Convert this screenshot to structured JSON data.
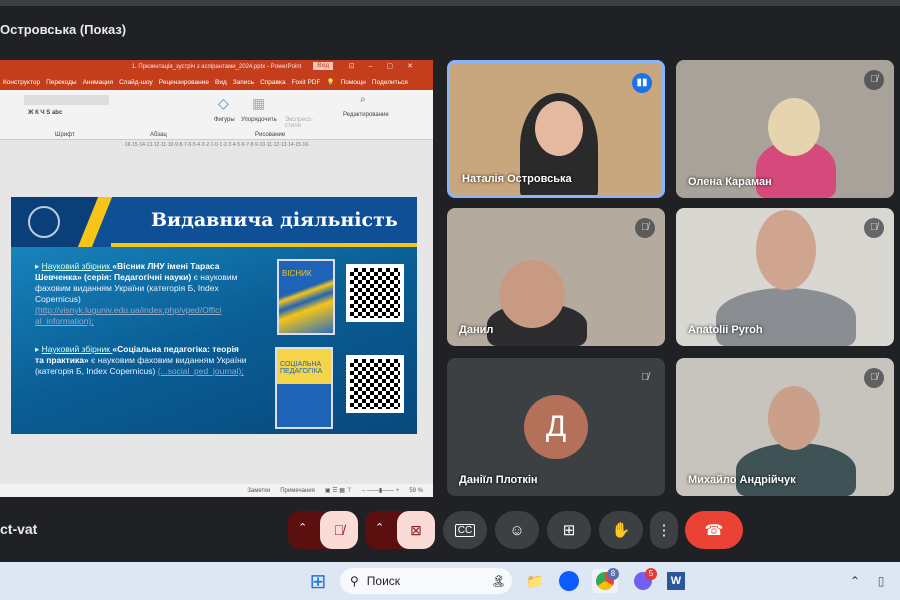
{
  "meeting": {
    "presenter_title": "Островська (Показ)",
    "meeting_code": "ct-vat"
  },
  "ppt": {
    "window_title": "1. Презентація_зустріч з аспірантами_2024.pptx - PowerPoint",
    "login_label": "Вхід",
    "menu": [
      "Конструктор",
      "Переходы",
      "Анимация",
      "Слайд-шоу",
      "Рецензирование",
      "Вид",
      "Запись",
      "Справка",
      "Foxit PDF",
      "Помощн",
      "Поделиться"
    ],
    "ribbon": {
      "font_group": "Шрифт",
      "paragraph_group": "Абзац",
      "drawing_group": "Рисование",
      "shapes": "Фигуры",
      "arrange": "Упорядочить",
      "express": "Экспресс-стили",
      "editing": "Редактирование"
    },
    "ruler": "·16·15·14·13·12·11·10·9·8·7·6·5·4·3·2·1·0·1·2·3·4·5·6·7·8·9·10·11·12·13·14·15·16·",
    "slide": {
      "title": "Видавнича діяльність",
      "bullet1": {
        "pre": "Науковий збірник ",
        "bold": "«Вісник ЛНУ імені Тараса Шевченка» (серія: Педагогічні науки)",
        "post": " є науковим фаховим виданням України (категорія Б, Index Copernicus)",
        "link": "(http://visnyk.luguniv.edu.ua/index.php/vped/Offici al_information);"
      },
      "bullet2": {
        "pre": "Науковий збірник ",
        "bold": "«Соціальна педагогіка: теорія та практика»",
        "post": " є науковим фаховим виданням України (категорія Б, Index Copernicus)",
        "link": "(...social_ped_journal);"
      },
      "cover1": "ВІСНИК",
      "cover2": "СОЦІАЛЬНА ПЕДАГОГІКА"
    },
    "status": {
      "notes": "Заметки",
      "comments": "Примечания",
      "zoom": "59 %"
    }
  },
  "participants": [
    {
      "name": "Наталія Островська",
      "speaking": true
    },
    {
      "name": "Олена Караман",
      "muted": true
    },
    {
      "name": "Данил",
      "muted": true
    },
    {
      "name": "Anatolii Pyroh",
      "muted": true
    },
    {
      "name": "Даніїл Плоткін",
      "muted": true,
      "initial": "Д"
    },
    {
      "name": "Михайло Андрійчук",
      "muted": true
    }
  ],
  "colors": {
    "end_call": "#ea4335",
    "speaking": "#1a73e8",
    "muted_bg": "#fadbd8"
  },
  "taskbar": {
    "search_placeholder": "Поиск",
    "chrome_badge": "8",
    "viber_badge": "5"
  }
}
